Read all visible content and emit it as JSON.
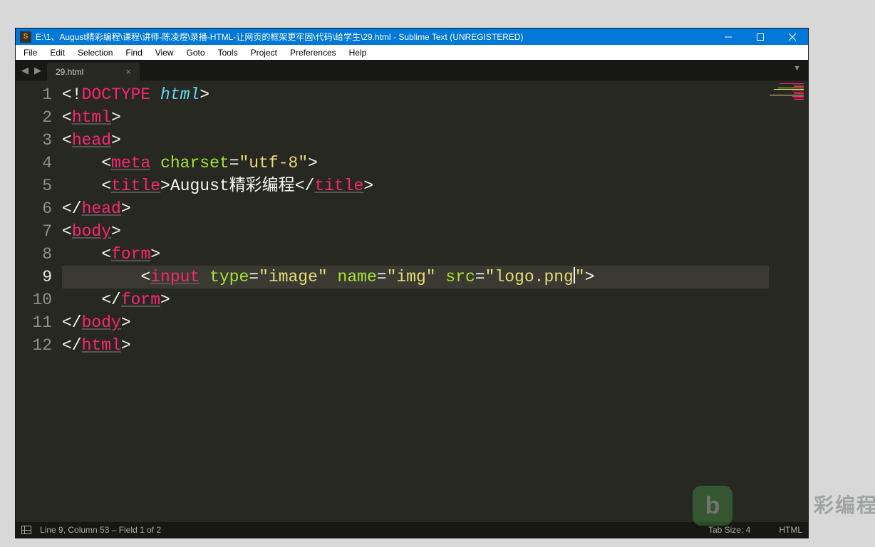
{
  "window": {
    "title": "E:\\1、August精彩编程\\课程\\讲师-陈凌煜\\录播-HTML-让网页的框架更牢固\\代码\\给学生\\29.html - Sublime Text (UNREGISTERED)"
  },
  "menu": [
    "File",
    "Edit",
    "Selection",
    "Find",
    "View",
    "Goto",
    "Tools",
    "Project",
    "Preferences",
    "Help"
  ],
  "tabs": [
    {
      "label": "29.html"
    }
  ],
  "gutter": [
    "1",
    "2",
    "3",
    "4",
    "5",
    "6",
    "7",
    "8",
    "9",
    "10",
    "11",
    "12"
  ],
  "active_line_index": 8,
  "code_title_text": "August精彩编程",
  "attrs": {
    "type": "image",
    "name": "img",
    "src": "logo.png"
  },
  "status": {
    "left": "Line 9, Column 53 – Field 1 of 2",
    "tabsize": "Tab Size: 4",
    "syntax": "HTML"
  },
  "watermark": {
    "icon": "b",
    "text": "彩编程"
  }
}
